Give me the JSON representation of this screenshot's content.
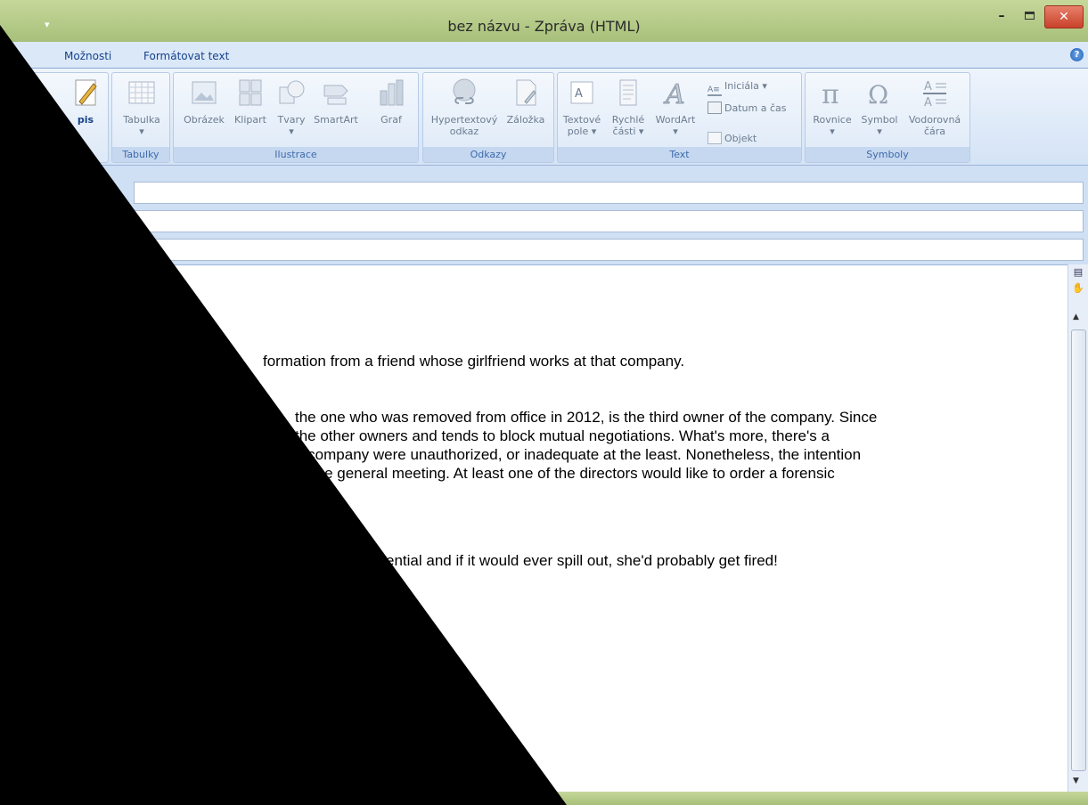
{
  "window": {
    "title": "bez názvu - Zpráva (HTML)",
    "qat_arrow": "▾",
    "minimize": "–",
    "close": "✕"
  },
  "tabs": [
    {
      "label": "Možnosti"
    },
    {
      "label": "Formátovat text"
    }
  ],
  "help": "?",
  "ribbon": {
    "partial_button": "pis",
    "groups": [
      {
        "label": "Tabulky",
        "buttons": [
          {
            "label": "Tabulka",
            "sub": "▾"
          }
        ]
      },
      {
        "label": "Ilustrace",
        "buttons": [
          {
            "label": "Obrázek"
          },
          {
            "label": "Klipart"
          },
          {
            "label": "Tvary",
            "sub": "▾"
          },
          {
            "label": "SmartArt"
          },
          {
            "label": "Graf"
          }
        ]
      },
      {
        "label": "Odkazy",
        "buttons": [
          {
            "label": "Hypertextový",
            "sub": "odkaz"
          },
          {
            "label": "Záložka"
          }
        ]
      },
      {
        "label": "Text",
        "buttons": [
          {
            "label": "Textové",
            "sub": "pole ▾"
          },
          {
            "label": "Rychlé",
            "sub": "části ▾"
          },
          {
            "label": "WordArt",
            "sub": "▾"
          }
        ],
        "small": [
          {
            "label": "Iniciála ▾"
          },
          {
            "label": "Datum a čas"
          },
          {
            "label": "Objekt"
          }
        ]
      },
      {
        "label": "Symboly",
        "buttons": [
          {
            "label": "Rovnice",
            "sub": "▾"
          },
          {
            "label": "Symbol",
            "sub": "▾"
          },
          {
            "label": "Vodorovná",
            "sub": "čára"
          }
        ]
      }
    ]
  },
  "body": {
    "line1": "formation from a friend whose girlfriend works at that company.",
    "line2": "the one who was removed from office in 2012, is the third owner of the company. Since",
    "line3": "the other owners and tends to block mutual negotiations. What's more, there's a",
    "line4": "e company were unauthorized, or inadequate at the least. Nonetheless, the intention",
    "line5": "at the general meeting. At least one of the directors would like to order a forensic",
    "line6": "ential and if it would ever spill out, she'd probably get fired!"
  },
  "colors": {
    "title_bar": "#b3c986",
    "ribbon_group_label": "#3e6aaa",
    "redaction": "#000000"
  }
}
